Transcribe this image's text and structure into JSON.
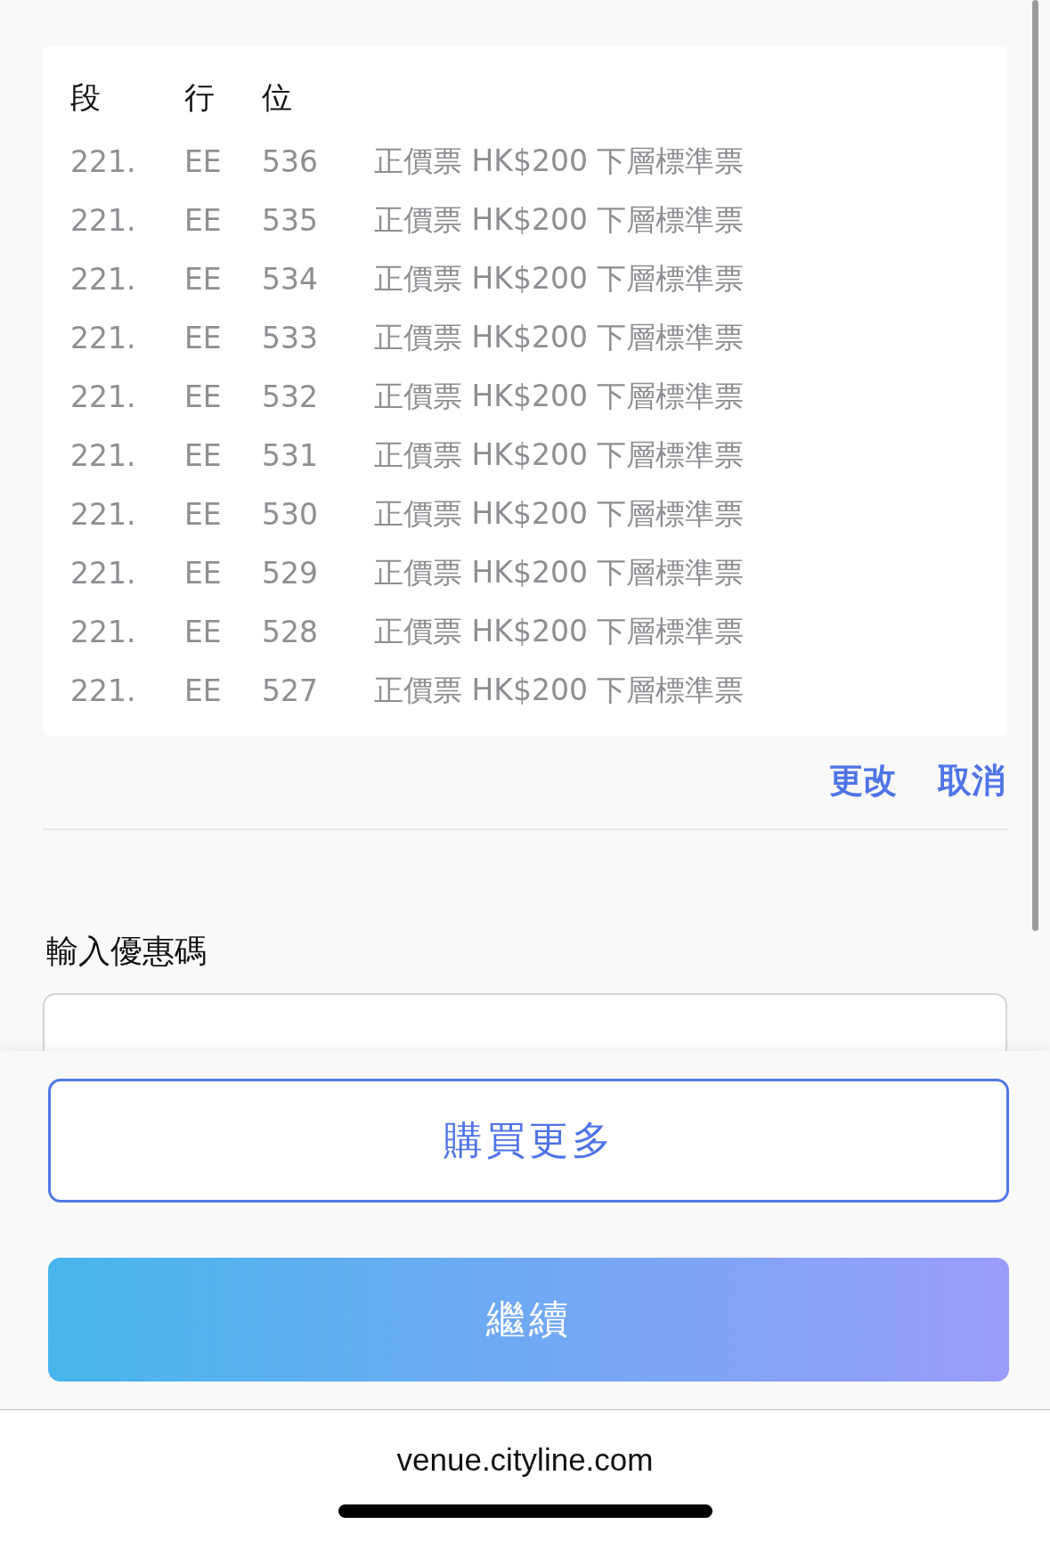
{
  "seat_table": {
    "columns": [
      "段",
      "行",
      "位"
    ],
    "rows": [
      {
        "section": "221.",
        "row": "EE",
        "seat": "536",
        "ticket": "正價票 HK$200 下層標準票"
      },
      {
        "section": "221.",
        "row": "EE",
        "seat": "535",
        "ticket": "正價票 HK$200 下層標準票"
      },
      {
        "section": "221.",
        "row": "EE",
        "seat": "534",
        "ticket": "正價票 HK$200 下層標準票"
      },
      {
        "section": "221.",
        "row": "EE",
        "seat": "533",
        "ticket": "正價票 HK$200 下層標準票"
      },
      {
        "section": "221.",
        "row": "EE",
        "seat": "532",
        "ticket": "正價票 HK$200 下層標準票"
      },
      {
        "section": "221.",
        "row": "EE",
        "seat": "531",
        "ticket": "正價票 HK$200 下層標準票"
      },
      {
        "section": "221.",
        "row": "EE",
        "seat": "530",
        "ticket": "正價票 HK$200 下層標準票"
      },
      {
        "section": "221.",
        "row": "EE",
        "seat": "529",
        "ticket": "正價票 HK$200 下層標準票"
      },
      {
        "section": "221.",
        "row": "EE",
        "seat": "528",
        "ticket": "正價票 HK$200 下層標準票"
      },
      {
        "section": "221.",
        "row": "EE",
        "seat": "527",
        "ticket": "正價票 HK$200 下層標準票"
      }
    ]
  },
  "actions": [
    "更改",
    "取消"
  ],
  "promo": {
    "label": "輸入優惠碼"
  },
  "buttons": [
    {
      "kind": "outline",
      "label": "購買更多"
    },
    {
      "kind": "gradient",
      "label": "繼續"
    }
  ],
  "browser": {
    "url": "venue.cityline.com"
  }
}
